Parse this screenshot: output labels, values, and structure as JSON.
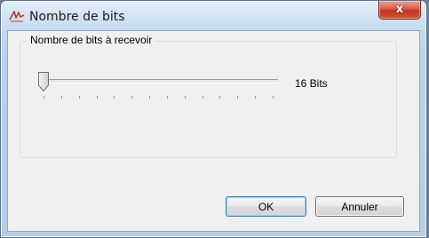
{
  "window": {
    "title": "Nombre de bits",
    "title_icon": "red-signature-icon",
    "close_label": "x"
  },
  "group": {
    "label": "Nombre de bits à recevoir"
  },
  "slider": {
    "value_text": "16 Bits",
    "position_fraction": 0.0,
    "tick_count": 14
  },
  "buttons": {
    "ok_label": "OK",
    "cancel_label": "Annuler"
  },
  "colors": {
    "close_button": "#c8452b",
    "title_icon": "#c0392b"
  }
}
